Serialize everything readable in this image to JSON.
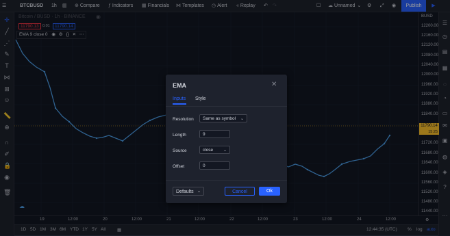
{
  "toolbar": {
    "symbol": "BTCBUSD",
    "interval": "1h",
    "compare_label": "Compare",
    "indicators_label": "Indicators",
    "financials_label": "Financials",
    "templates_label": "Templates",
    "alert_label": "Alert",
    "replay_label": "Replay",
    "layout_name": "Unnamed",
    "publish_label": "Publish"
  },
  "legend": {
    "symbol_line": "Bitcoin / BUSD · 1h · BINANCE",
    "bid": "11790.13",
    "spread": "0.01",
    "ask": "11790.14",
    "ema_label": "EMA 9 close 0"
  },
  "price_scale": {
    "currency": "BUSD",
    "labels": [
      "12200.00",
      "12160.00",
      "12120.00",
      "12080.00",
      "12040.00",
      "12000.00",
      "11960.00",
      "11920.00",
      "11880.00",
      "11840.00",
      "11800.00",
      "11760.00",
      "11720.00",
      "11680.00",
      "11640.00",
      "11600.00",
      "11560.00",
      "11520.00",
      "11480.00",
      "11440.00"
    ],
    "current_price": "11790.14",
    "countdown": "15:25"
  },
  "time_scale": {
    "labels": [
      "19",
      "12:00",
      "20",
      "12:00",
      "21",
      "12:00",
      "22",
      "12:00",
      "23",
      "12:00",
      "24",
      "12:00"
    ]
  },
  "bottom_bar": {
    "ranges": [
      "1D",
      "5D",
      "1M",
      "3M",
      "6M",
      "YTD",
      "1Y",
      "5Y",
      "All"
    ],
    "clock": "12:44:35 (UTC)",
    "percent": "%",
    "log": "log",
    "auto": "auto"
  },
  "dialog": {
    "title": "EMA",
    "tabs": [
      "Inputs",
      "Style"
    ],
    "fields": {
      "resolution_label": "Resolution",
      "resolution_value": "Same as symbol",
      "length_label": "Length",
      "length_value": "9",
      "source_label": "Source",
      "source_value": "close",
      "offset_label": "Offset",
      "offset_value": "0"
    },
    "defaults_label": "Defaults",
    "cancel_label": "Cancel",
    "ok_label": "Ok"
  },
  "colors": {
    "accent": "#2962ff",
    "ema_line": "#4c9ee8",
    "price_label": "#fbc02d",
    "bid_red": "#f23645"
  }
}
